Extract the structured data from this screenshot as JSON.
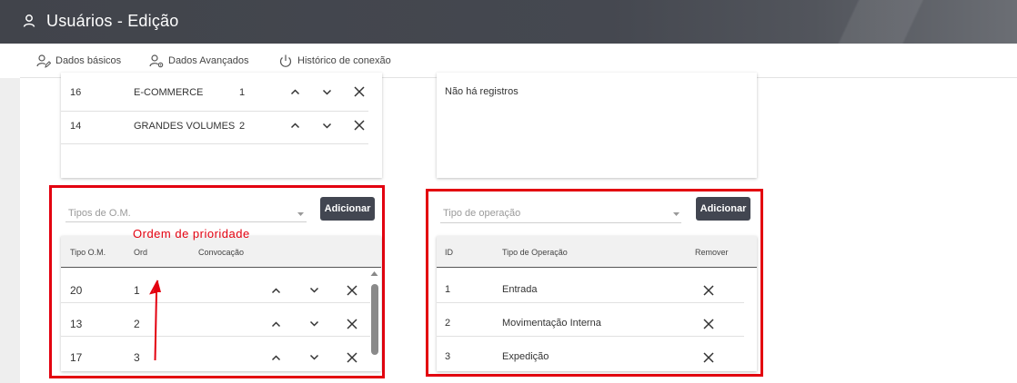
{
  "header": {
    "title": "Usuários - Edição"
  },
  "tabs": [
    {
      "label": "Dados básicos"
    },
    {
      "label": "Dados Avançados"
    },
    {
      "label": "Histórico de conexão"
    }
  ],
  "top_left_table": {
    "rows": [
      {
        "id": "16",
        "name": "E-COMMERCE",
        "ord": "1"
      },
      {
        "id": "14",
        "name": "GRANDES VOLUMES",
        "ord": "2"
      }
    ]
  },
  "top_right_card": {
    "empty_text": "Não há registros"
  },
  "om_panel": {
    "select_placeholder": "Tipos de O.M.",
    "add_label": "Adicionar",
    "columns": [
      "Tipo O.M.",
      "Ord",
      "Convocação"
    ],
    "rows": [
      {
        "tipo": "20",
        "ord": "1"
      },
      {
        "tipo": "13",
        "ord": "2"
      },
      {
        "tipo": "17",
        "ord": "3"
      }
    ]
  },
  "op_panel": {
    "select_placeholder": "Tipo de operação",
    "add_label": "Adicionar",
    "columns": [
      "ID",
      "Tipo de Operação",
      "Remover"
    ],
    "rows": [
      {
        "id": "1",
        "tipo": "Entrada"
      },
      {
        "id": "2",
        "tipo": "Movimentação Interna"
      },
      {
        "id": "3",
        "tipo": "Expedição"
      }
    ]
  },
  "annotation": {
    "text": "Ordem de prioridade"
  },
  "colors": {
    "header": "#43464d",
    "button": "#424651",
    "annotation_red": "#e3000f"
  }
}
